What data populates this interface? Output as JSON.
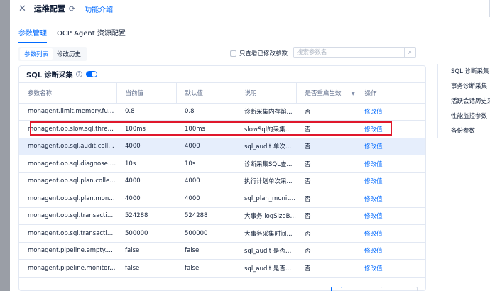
{
  "header": {
    "title": "运维配置",
    "help_link": "功能介绍"
  },
  "tabs": [
    {
      "label": "参数管理",
      "active": true
    },
    {
      "label": "OCP Agent 资源配置",
      "active": false
    }
  ],
  "subtabs": [
    {
      "label": "参数列表",
      "active": true
    },
    {
      "label": "修改历史",
      "active": false
    }
  ],
  "filter": {
    "only_modified_label": "只查看已修改参数",
    "only_modified_checked": false,
    "search_placeholder": "搜索参数名"
  },
  "section": {
    "title": "SQL 诊断采集",
    "enabled": true
  },
  "table": {
    "columns": [
      "参数名称",
      "当前值",
      "默认值",
      "说明",
      "是否重启生效",
      "操作"
    ],
    "rows": [
      {
        "name": "monagent.limit.memory.fuse.pe...",
        "current": "0.8",
        "default": "0.8",
        "desc": "诊断采集内存熔...",
        "restart": "否",
        "action": "修改值"
      },
      {
        "name": "monagent.ob.slow.sql.threshold",
        "current": "100ms",
        "default": "100ms",
        "desc": "slowSql的采集阈值",
        "restart": "否",
        "action": "修改值"
      },
      {
        "name": "monagent.ob.sql.audit.collect.b...",
        "current": "4000",
        "default": "4000",
        "desc": "sql_audit 单次查...",
        "restart": "否",
        "action": "修改值"
      },
      {
        "name": "monagent.ob.sql.diagnose.colle...",
        "current": "10s",
        "default": "10s",
        "desc": "诊断采集SQL查...",
        "restart": "否",
        "action": "修改值"
      },
      {
        "name": "monagent.ob.sql.plan.collect.b...",
        "current": "4000",
        "default": "4000",
        "desc": "执行计划单次采...",
        "restart": "否",
        "action": "修改值"
      },
      {
        "name": "monagent.ob.sql.plan.monitor.c...",
        "current": "4000",
        "default": "4000",
        "desc": "sql_plan_monito...",
        "restart": "否",
        "action": "修改值"
      },
      {
        "name": "monagent.ob.sql.transaction.lo...",
        "current": "524288",
        "default": "524288",
        "desc": "大事务 logSizeBy...",
        "restart": "否",
        "action": "修改值"
      },
      {
        "name": "monagent.ob.sql.transaction.ti...",
        "current": "500000",
        "default": "500000",
        "desc": "大事务采集时间...",
        "restart": "否",
        "action": "修改值"
      },
      {
        "name": "monagent.pipeline.empty.query....",
        "current": "false",
        "default": "false",
        "desc": "sql_audit 是否采...",
        "restart": "否",
        "action": "修改值"
      },
      {
        "name": "monagent.pipeline.monitor.user....",
        "current": "false",
        "default": "false",
        "desc": "sql_audit 是否采...",
        "restart": "否",
        "action": "修改值"
      }
    ]
  },
  "anchor_nav": [
    "SQL 诊断采集",
    "事务诊断采集",
    "活跃会话历史采集",
    "性能监控参数",
    "备份参数"
  ],
  "colors": {
    "accent": "#006aff",
    "highlight_box": "#e0182c",
    "hover_row": "#e6eefc"
  }
}
